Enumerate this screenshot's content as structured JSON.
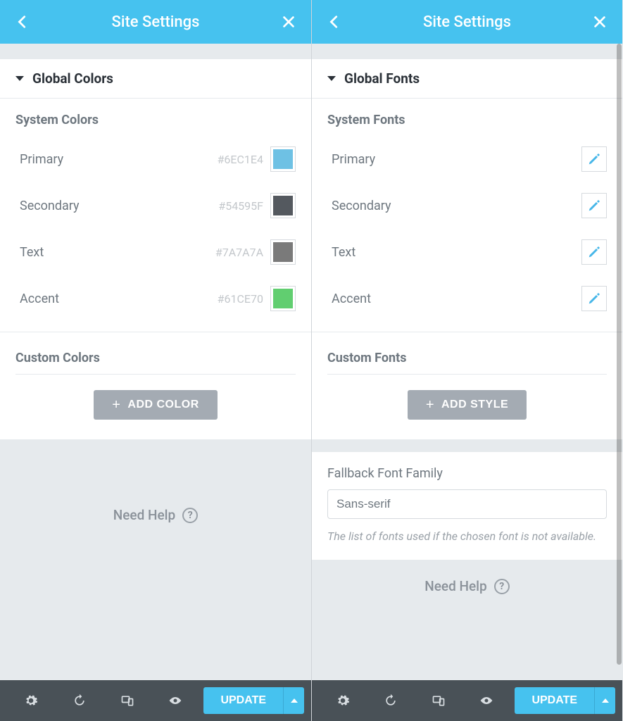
{
  "left": {
    "header_title": "Site Settings",
    "section_title": "Global Colors",
    "system_heading": "System Colors",
    "custom_heading": "Custom Colors",
    "add_label": "ADD COLOR",
    "system_colors": [
      {
        "name": "Primary",
        "hex": "#6EC1E4",
        "swatch": "#6EC1E4"
      },
      {
        "name": "Secondary",
        "hex": "#54595F",
        "swatch": "#54595F"
      },
      {
        "name": "Text",
        "hex": "#7A7A7A",
        "swatch": "#7A7A7A"
      },
      {
        "name": "Accent",
        "hex": "#61CE70",
        "swatch": "#61CE70"
      }
    ],
    "help_text": "Need Help",
    "update_label": "UPDATE"
  },
  "right": {
    "header_title": "Site Settings",
    "section_title": "Global Fonts",
    "system_heading": "System Fonts",
    "custom_heading": "Custom Fonts",
    "add_label": "ADD STYLE",
    "system_fonts": [
      {
        "name": "Primary"
      },
      {
        "name": "Secondary"
      },
      {
        "name": "Text"
      },
      {
        "name": "Accent"
      }
    ],
    "fallback_label": "Fallback Font Family",
    "fallback_value": "Sans-serif",
    "fallback_desc": "The list of fonts used if the chosen font is not available.",
    "help_text": "Need Help",
    "update_label": "UPDATE"
  }
}
